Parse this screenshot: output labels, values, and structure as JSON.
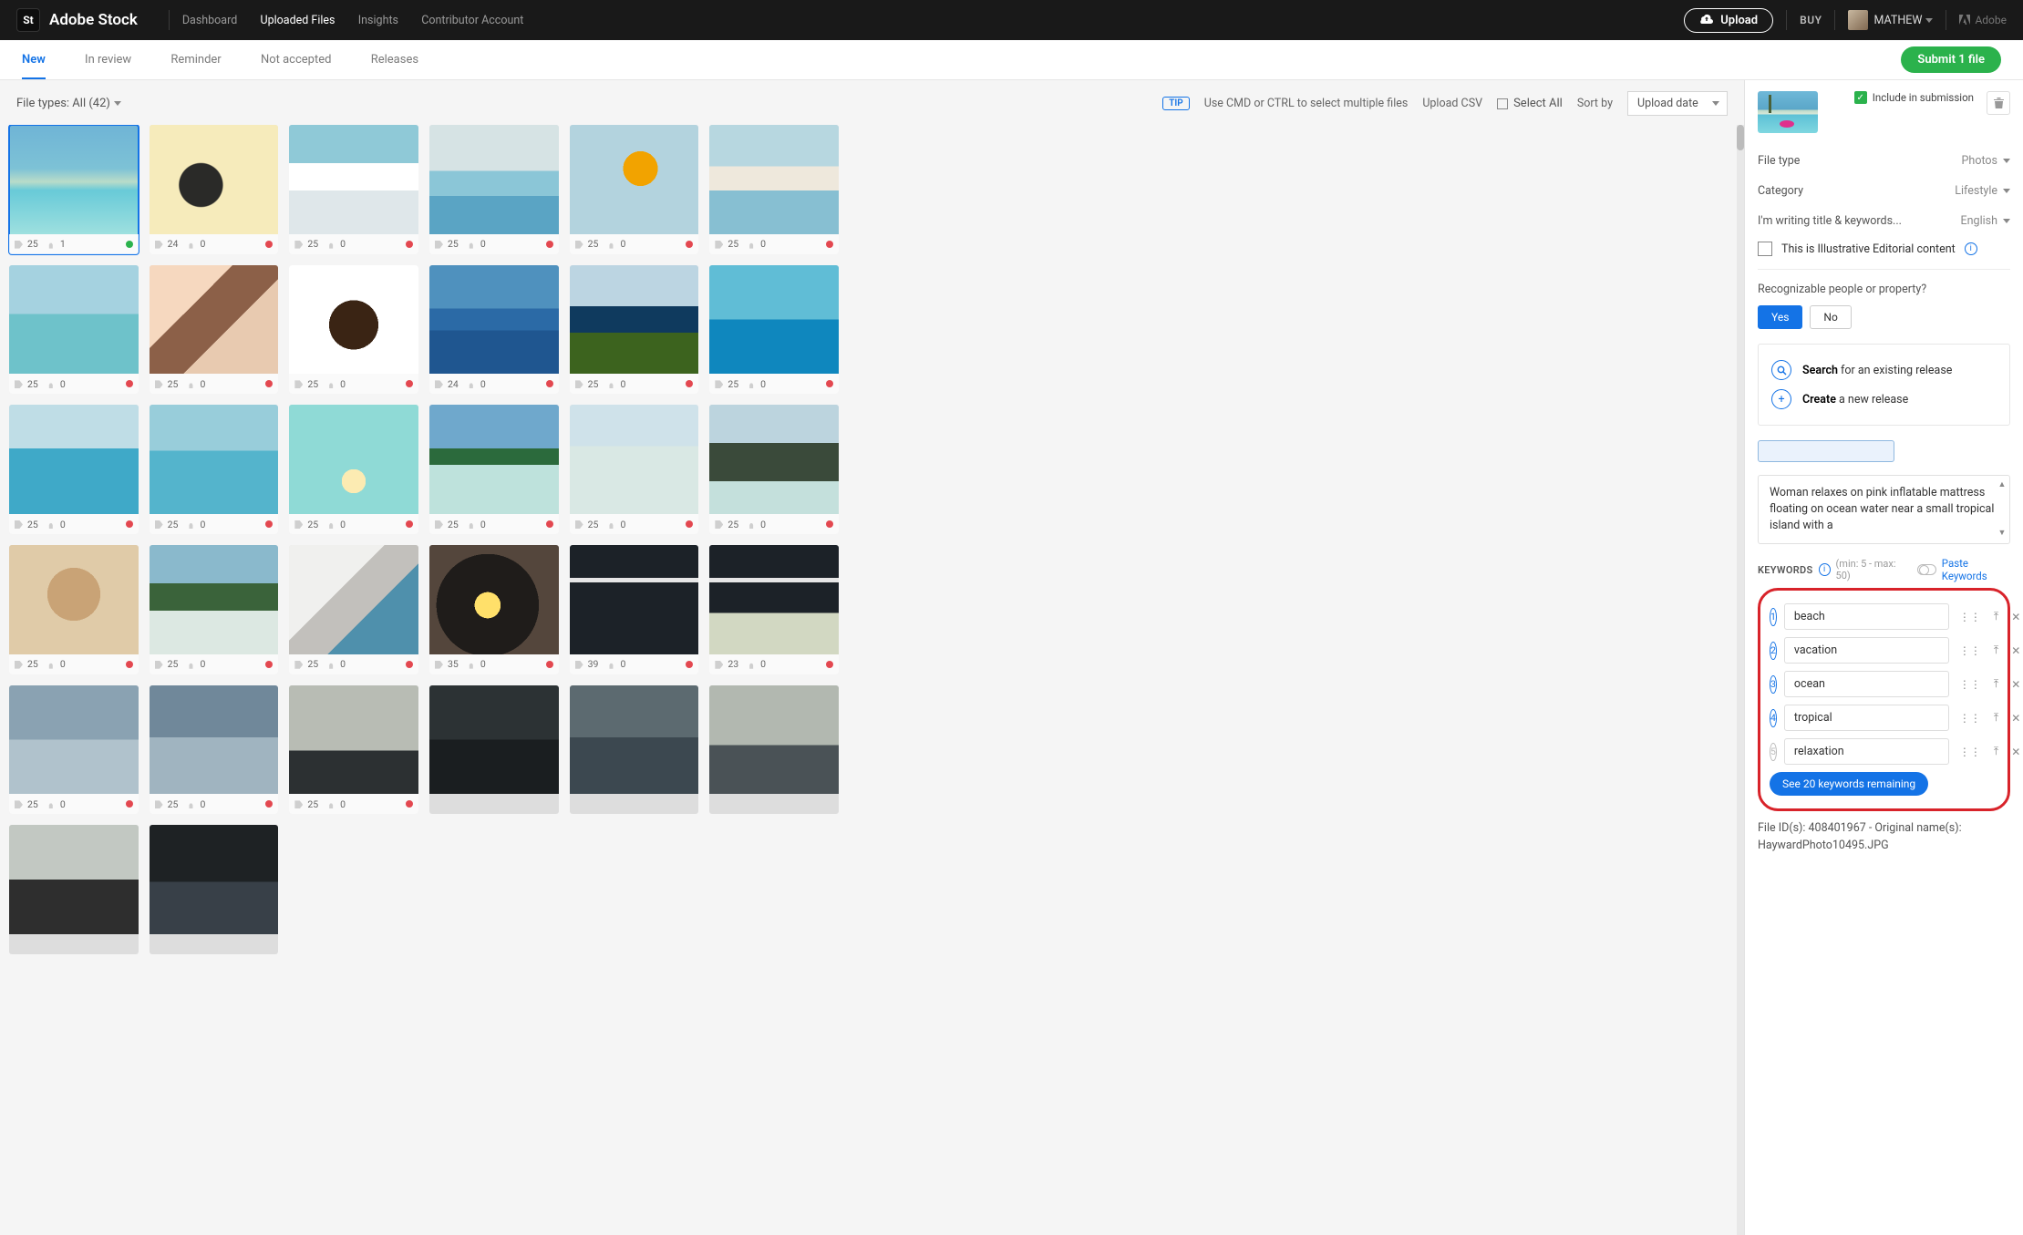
{
  "header": {
    "logo_badge": "St",
    "brand": "Adobe Stock",
    "nav": {
      "dashboard": "Dashboard",
      "uploaded": "Uploaded Files",
      "insights": "Insights",
      "contributor": "Contributor Account"
    },
    "upload_btn": "Upload",
    "buy": "BUY",
    "username": "MATHEW",
    "adobe_mark": "Adobe"
  },
  "subnav": {
    "tabs": {
      "new": "New",
      "in_review": "In review",
      "reminder": "Reminder",
      "not_accepted": "Not accepted",
      "releases": "Releases"
    },
    "submit": "Submit 1 file"
  },
  "toolbar": {
    "file_types": "File types: All (42)",
    "tip_badge": "TIP",
    "tip_text": "Use CMD or CTRL to select multiple files",
    "upload_csv": "Upload CSV",
    "select_all": "Select All",
    "sortby": "Sort by",
    "sort_value": "Upload date"
  },
  "thumbs": [
    {
      "tags": "25",
      "ppl": "1",
      "dot": "green",
      "g": "g0",
      "sel": true
    },
    {
      "tags": "24",
      "ppl": "0",
      "dot": "red",
      "g": "g1"
    },
    {
      "tags": "25",
      "ppl": "0",
      "dot": "red",
      "g": "g2"
    },
    {
      "tags": "25",
      "ppl": "0",
      "dot": "red",
      "g": "g3"
    },
    {
      "tags": "25",
      "ppl": "0",
      "dot": "red",
      "g": "g4"
    },
    {
      "tags": "25",
      "ppl": "0",
      "dot": "red",
      "g": "g5"
    },
    {
      "tags": "25",
      "ppl": "0",
      "dot": "red",
      "g": "g6"
    },
    {
      "tags": "25",
      "ppl": "0",
      "dot": "red",
      "g": "g7"
    },
    {
      "tags": "25",
      "ppl": "0",
      "dot": "red",
      "g": "g8"
    },
    {
      "tags": "24",
      "ppl": "0",
      "dot": "red",
      "g": "g9"
    },
    {
      "tags": "25",
      "ppl": "0",
      "dot": "red",
      "g": "g10"
    },
    {
      "tags": "25",
      "ppl": "0",
      "dot": "red",
      "g": "g11"
    },
    {
      "tags": "25",
      "ppl": "0",
      "dot": "red",
      "g": "g12"
    },
    {
      "tags": "25",
      "ppl": "0",
      "dot": "red",
      "g": "g13"
    },
    {
      "tags": "25",
      "ppl": "0",
      "dot": "red",
      "g": "g14"
    },
    {
      "tags": "25",
      "ppl": "0",
      "dot": "red",
      "g": "g15"
    },
    {
      "tags": "25",
      "ppl": "0",
      "dot": "red",
      "g": "g16"
    },
    {
      "tags": "25",
      "ppl": "0",
      "dot": "red",
      "g": "g17"
    },
    {
      "tags": "25",
      "ppl": "0",
      "dot": "red",
      "g": "g18"
    },
    {
      "tags": "25",
      "ppl": "0",
      "dot": "red",
      "g": "g19"
    },
    {
      "tags": "25",
      "ppl": "0",
      "dot": "red",
      "g": "g20"
    },
    {
      "tags": "35",
      "ppl": "0",
      "dot": "red",
      "g": "g21"
    },
    {
      "tags": "39",
      "ppl": "0",
      "dot": "red",
      "g": "g22"
    },
    {
      "tags": "23",
      "ppl": "0",
      "dot": "red",
      "g": "g23"
    },
    {
      "tags": "25",
      "ppl": "0",
      "dot": "red",
      "g": "g24"
    },
    {
      "tags": "25",
      "ppl": "0",
      "dot": "red",
      "g": "g25"
    },
    {
      "tags": "25",
      "ppl": "0",
      "dot": "red",
      "g": "g26"
    },
    {
      "tags": "",
      "ppl": "",
      "dot": "",
      "g": "g27",
      "nometa": true
    },
    {
      "tags": "",
      "ppl": "",
      "dot": "",
      "g": "g28",
      "nometa": true
    },
    {
      "tags": "",
      "ppl": "",
      "dot": "",
      "g": "g29",
      "nometa": true
    },
    {
      "tags": "",
      "ppl": "",
      "dot": "",
      "g": "g30",
      "nometa": true
    },
    {
      "tags": "",
      "ppl": "",
      "dot": "",
      "g": "g31",
      "nometa": true
    }
  ],
  "side": {
    "include": "Include in submission",
    "fields": {
      "file_type_l": "File type",
      "file_type_v": "Photos",
      "category_l": "Category",
      "category_v": "Lifestyle",
      "lang_l": "I'm writing title & keywords...",
      "lang_v": "English"
    },
    "editorial": "This is Illustrative Editorial content",
    "recog": "Recognizable people or property?",
    "yes": "Yes",
    "no": "No",
    "search_rel": "Search",
    "search_rel_txt": " for an existing release",
    "create_rel": "Create",
    "create_rel_txt": " a new release",
    "desc": "Woman relaxes on pink inflatable mattress floating on ocean water near a small tropical island with a",
    "kw_title": "KEYWORDS",
    "kw_range": "(min: 5 - max: 50)",
    "paste": "Paste Keywords",
    "keywords": [
      "beach",
      "vacation",
      "ocean",
      "tropical",
      "relaxation"
    ],
    "see_more": "See 20 keywords remaining",
    "fileid": "File ID(s): 408401967 - Original name(s): HaywardPhoto10495.JPG"
  }
}
